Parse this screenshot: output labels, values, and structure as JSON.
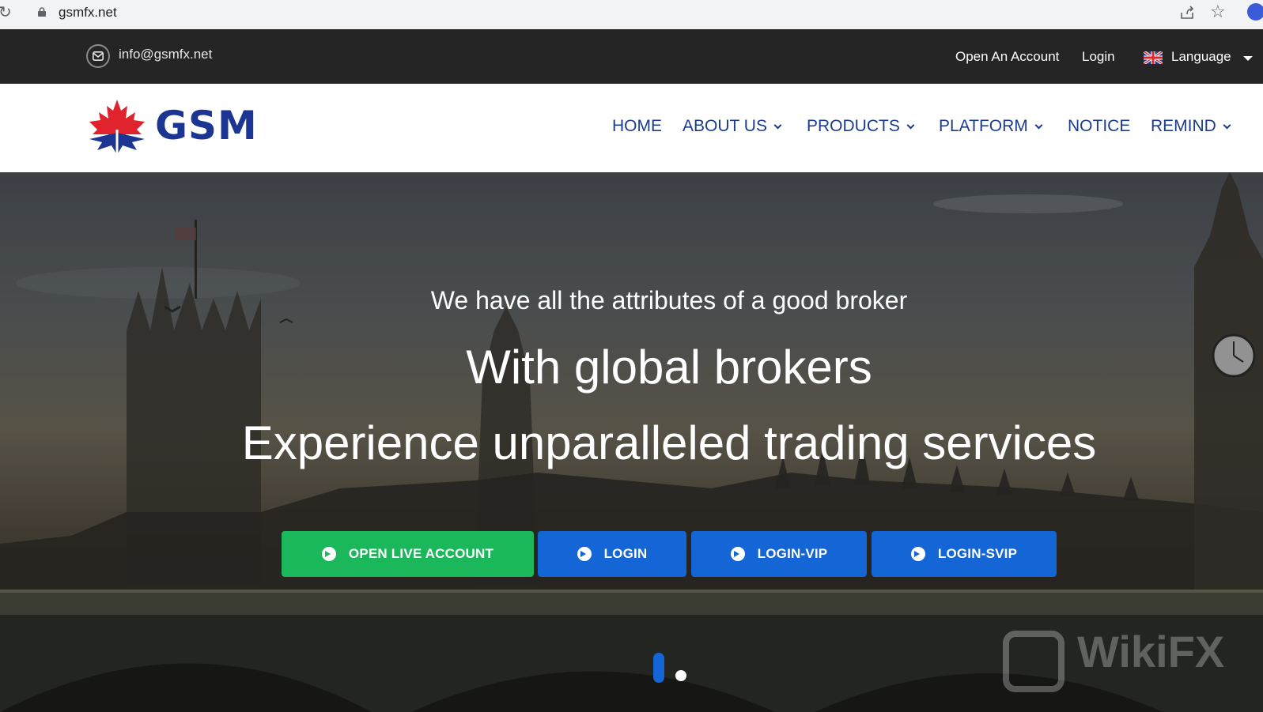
{
  "browser": {
    "url": "gsmfx.net"
  },
  "topbar": {
    "email": "info@gsmfx.net",
    "open_account": "Open An Account",
    "login": "Login",
    "language": "Language"
  },
  "header": {
    "logo_text": "GSM",
    "nav": [
      {
        "label": "HOME"
      },
      {
        "label": "ABOUT US"
      },
      {
        "label": "PRODUCTS"
      },
      {
        "label": "PLATFORM"
      },
      {
        "label": "NOTICE"
      },
      {
        "label": "REMIND"
      }
    ]
  },
  "hero": {
    "tagline": "We have all the attributes of a good broker",
    "headline1": "With global brokers",
    "headline2": "Experience unparalleled trading services",
    "buttons": [
      {
        "label": "OPEN LIVE ACCOUNT"
      },
      {
        "label": "LOGIN"
      },
      {
        "label": "LOGIN-VIP"
      },
      {
        "label": "LOGIN-SVIP"
      }
    ],
    "slide_count": 2,
    "active_slide": 1
  },
  "watermark": "WikiFX",
  "colors": {
    "topbar_bg": "#252525",
    "nav_text": "#1c3d8c",
    "logo_blue": "#1d3592",
    "logo_red": "#e0232d",
    "btn_green": "#1ab85a",
    "btn_blue": "#1466d6"
  }
}
